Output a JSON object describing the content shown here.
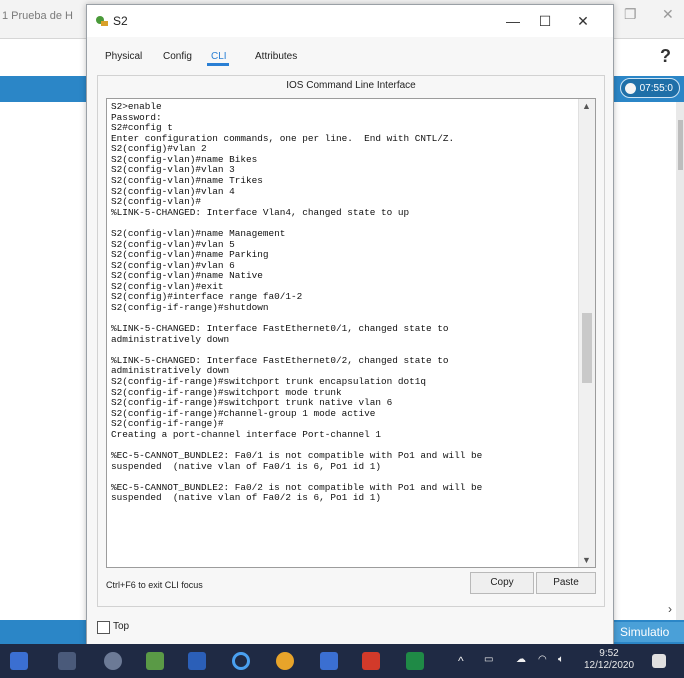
{
  "background": {
    "left_window_title": "1 Prueba de H",
    "help_glyph": "?",
    "time_pill": "07:55:0",
    "simulation_label": "Simulatio",
    "top_checkbox_label": "Top"
  },
  "window": {
    "title": "S2",
    "controls": {
      "minimize": "—",
      "maximize": "☐",
      "close": "✕"
    }
  },
  "tabs": [
    {
      "label": "Physical"
    },
    {
      "label": "Config"
    },
    {
      "label": "CLI",
      "active": true
    },
    {
      "label": "Attributes"
    }
  ],
  "cli": {
    "panel_title": "IOS Command Line Interface",
    "focus_hint": "Ctrl+F6 to exit CLI focus",
    "copy_label": "Copy",
    "paste_label": "Paste",
    "lines": [
      "S2>enable",
      "Password:",
      "S2#config t",
      "Enter configuration commands, one per line.  End with CNTL/Z.",
      "S2(config)#vlan 2",
      "S2(config-vlan)#name Bikes",
      "S2(config-vlan)#vlan 3",
      "S2(config-vlan)#name Trikes",
      "S2(config-vlan)#vlan 4",
      "S2(config-vlan)#",
      "%LINK-5-CHANGED: Interface Vlan4, changed state to up",
      "",
      "S2(config-vlan)#name Management",
      "S2(config-vlan)#vlan 5",
      "S2(config-vlan)#name Parking",
      "S2(config-vlan)#vlan 6",
      "S2(config-vlan)#name Native",
      "S2(config-vlan)#exit",
      "S2(config)#interface range fa0/1-2",
      "S2(config-if-range)#shutdown",
      "",
      "%LINK-5-CHANGED: Interface FastEthernet0/1, changed state to",
      "administratively down",
      "",
      "%LINK-5-CHANGED: Interface FastEthernet0/2, changed state to",
      "administratively down",
      "S2(config-if-range)#switchport trunk encapsulation dot1q",
      "S2(config-if-range)#switchport mode trunk",
      "S2(config-if-range)#switchport trunk native vlan 6",
      "S2(config-if-range)#channel-group 1 mode active",
      "S2(config-if-range)#",
      "Creating a port-channel interface Port-channel 1",
      "",
      "%EC-5-CANNOT_BUNDLE2: Fa0/1 is not compatible with Po1 and will be",
      "suspended  (native vlan of Fa0/1 is 6, Po1 id 1)",
      "",
      "%EC-5-CANNOT_BUNDLE2: Fa0/2 is not compatible with Po1 and will be",
      "suspended  (native vlan of Fa0/2 is 6, Po1 id 1)"
    ]
  },
  "taskbar": {
    "time": "9:52",
    "date": "12/12/2020",
    "tray_chevron": "^"
  }
}
